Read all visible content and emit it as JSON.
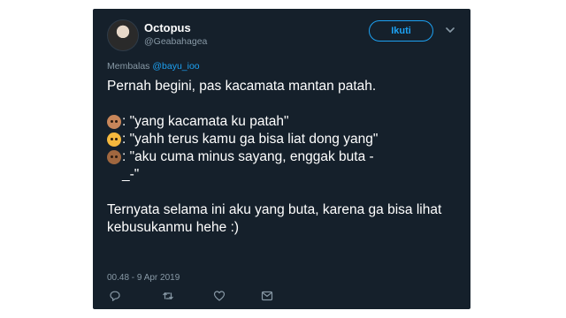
{
  "tweet": {
    "name": "Octopus",
    "handle": "@Geabahagea",
    "follow_label": "Ikuti",
    "reply_prefix": "Membalas",
    "reply_handle": "@bayu_ioo",
    "lines": {
      "intro": "Pernah begini, pas kacamata mantan patah.",
      "dog": ": \"yang kacamata ku patah\"",
      "cat": ": \"yahh terus kamu ga bisa liat dong yang\"",
      "monkey": ": \"aku cuma minus sayang, enggak buta -\n_-\"",
      "outro": "Ternyata selama ini aku yang buta, karena ga bisa lihat kebusukanmu hehe :)"
    },
    "timestamp": "00.48 - 9 Apr 2019",
    "icons": [
      "reply-icon",
      "retweet-icon",
      "like-icon",
      "message-icon",
      "chevron-down-icon"
    ],
    "colors": {
      "background": "#15202b",
      "accent": "#1da1f2",
      "muted": "#8899a6",
      "text": "#ffffff"
    }
  }
}
